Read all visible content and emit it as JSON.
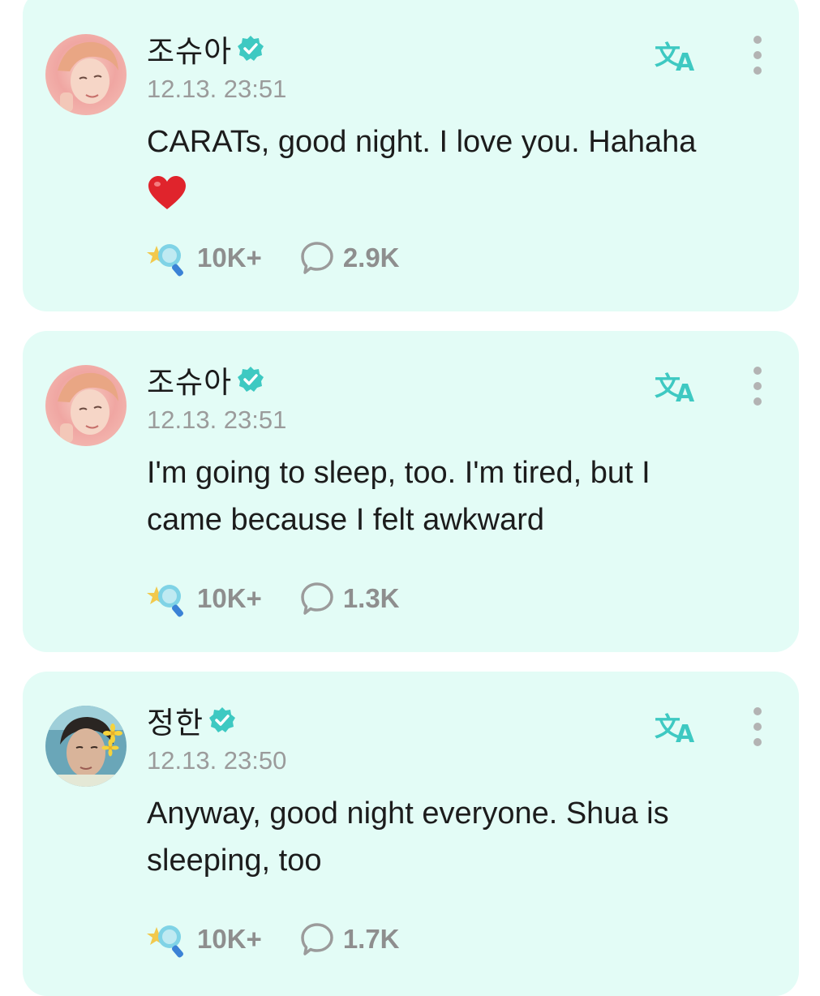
{
  "posts": [
    {
      "author": "조슈아",
      "timestamp": "12.13. 23:51",
      "text": "CARATs, good night. I love you. Hahaha",
      "emoji": "heart-emoji",
      "likes": "10K+",
      "comments": "2.9K"
    },
    {
      "author": "조슈아",
      "timestamp": "12.13. 23:51",
      "text": "I'm going to sleep, too. I'm tired, but I came because I felt awkward",
      "likes": "10K+",
      "comments": "1.3K"
    },
    {
      "author": "정한",
      "timestamp": "12.13. 23:50",
      "text": "Anyway, good night everyone. Shua is sleeping, too",
      "likes": "10K+",
      "comments": "1.7K"
    }
  ],
  "icons": {
    "verified": "verified-badge-icon",
    "translate": "translate-icon",
    "more": "more-vertical-icon",
    "like": "light-stick-icon",
    "comment": "comment-bubble-icon"
  },
  "colors": {
    "card_background": "#e3fcf6",
    "accent_teal": "#3ec9c2",
    "muted_text": "#9b9b9b",
    "heart_red": "#e0242c"
  }
}
